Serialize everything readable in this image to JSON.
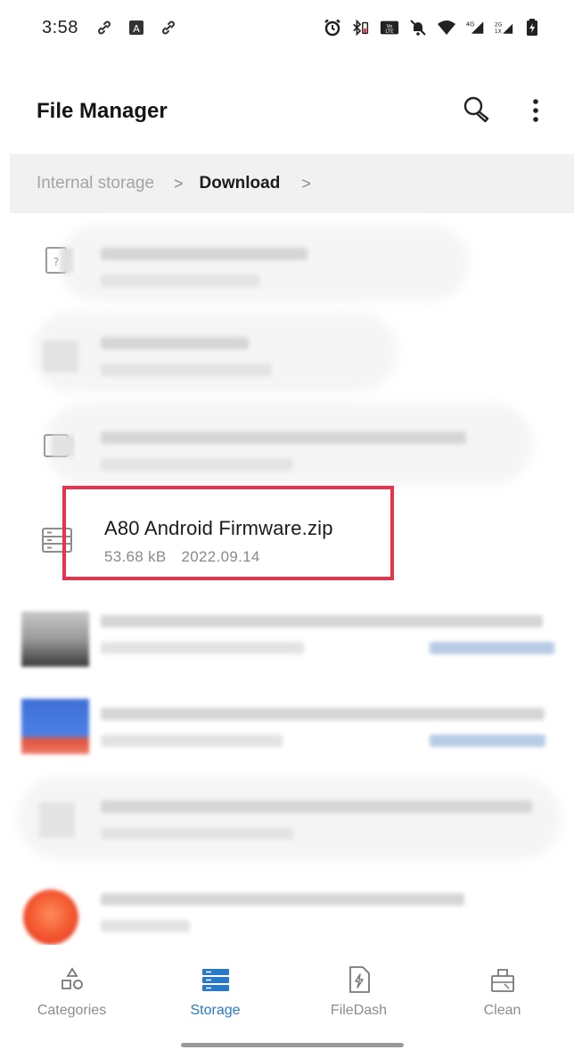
{
  "status_bar": {
    "time": "3:58",
    "left_icons": [
      "link-icon",
      "a-box-icon",
      "link-icon"
    ],
    "right_icons": [
      "alarm-icon",
      "bluetooth-battery-icon",
      "volte-icon",
      "mute-icon",
      "wifi-icon",
      "signal-4g-icon",
      "signal-2g-icon",
      "battery-charging-icon"
    ]
  },
  "app_bar": {
    "title": "File Manager",
    "search_icon": "search-icon",
    "more_icon": "more-vertical-icon"
  },
  "breadcrumb": {
    "root": "Internal storage",
    "separator": ">",
    "current": "Download"
  },
  "files": {
    "highlighted": {
      "name": "A80 Android Firmware.zip",
      "size": "53.68 kB",
      "date": "2022.09.14",
      "icon": "archive-icon"
    }
  },
  "bottom_nav": {
    "items": [
      {
        "label": "Categories",
        "icon": "categories-icon",
        "active": false
      },
      {
        "label": "Storage",
        "icon": "storage-icon",
        "active": true
      },
      {
        "label": "FileDash",
        "icon": "filedash-icon",
        "active": false
      },
      {
        "label": "Clean",
        "icon": "clean-icon",
        "active": false
      }
    ]
  },
  "colors": {
    "accent": "#2979c9",
    "highlight_border": "#e8334a",
    "breadcrumb_bg": "#f1f1f1"
  }
}
